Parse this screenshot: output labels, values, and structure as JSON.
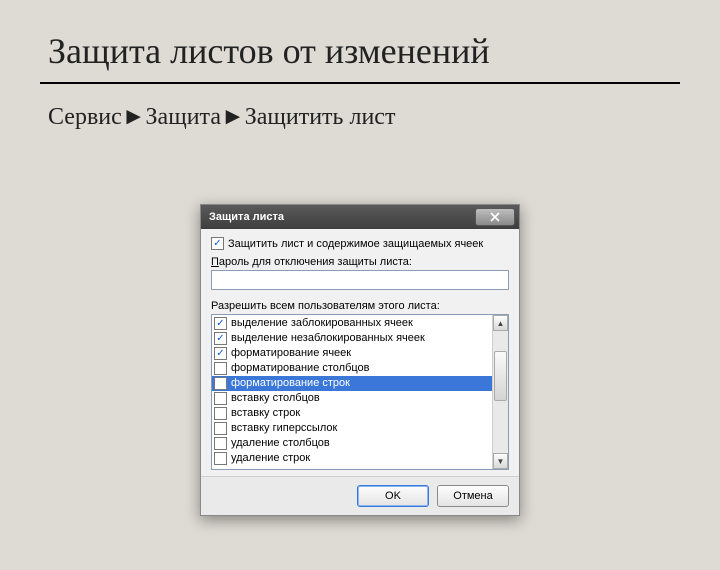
{
  "slide": {
    "title": "Защита листов от изменений",
    "menu_path": "Сервис►Защита►Защитить лист"
  },
  "dialog": {
    "title": "Защита листа",
    "protect_checkbox_label": "Защитить лист и содержимое защищаемых ячеек",
    "protect_checked": true,
    "password_label_pre": "П",
    "password_label_rest": "ароль для отключения защиты листа:",
    "password_value": "",
    "allow_label": "Разрешить всем пользователям этого листа:",
    "permissions": [
      {
        "label": "выделение заблокированных ячеек",
        "checked": true,
        "selected": false
      },
      {
        "label": "выделение незаблокированных ячеек",
        "checked": true,
        "selected": false
      },
      {
        "label": "форматирование ячеек",
        "checked": true,
        "selected": false
      },
      {
        "label": "форматирование столбцов",
        "checked": false,
        "selected": false
      },
      {
        "label": "форматирование строк",
        "checked": false,
        "selected": true
      },
      {
        "label": "вставку столбцов",
        "checked": false,
        "selected": false
      },
      {
        "label": "вставку строк",
        "checked": false,
        "selected": false
      },
      {
        "label": "вставку гиперссылок",
        "checked": false,
        "selected": false
      },
      {
        "label": "удаление столбцов",
        "checked": false,
        "selected": false
      },
      {
        "label": "удаление строк",
        "checked": false,
        "selected": false
      }
    ],
    "ok_label": "OK",
    "cancel_label": "Отмена"
  }
}
